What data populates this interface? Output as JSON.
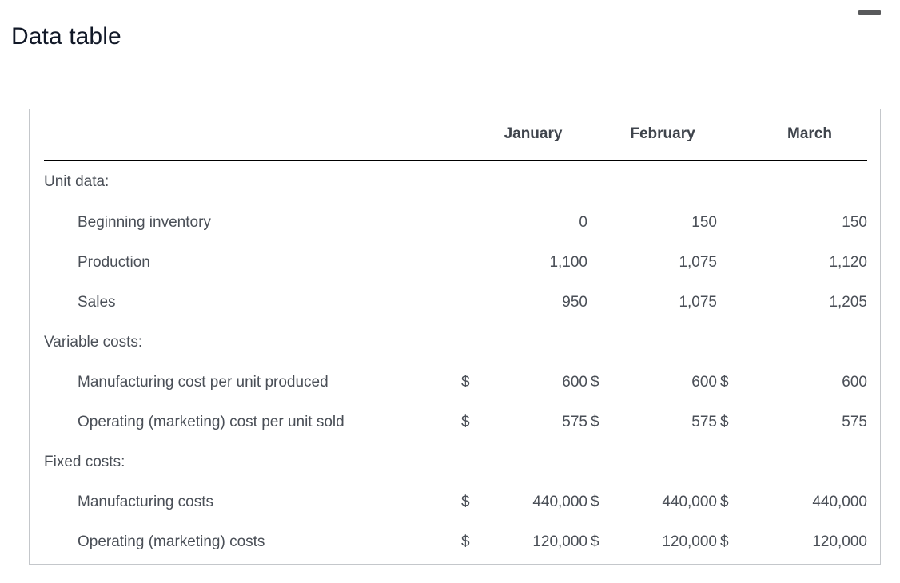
{
  "window": {
    "minimize_icon": "minimize-icon"
  },
  "page_title": "Data table",
  "table": {
    "columns": [
      "",
      "January",
      "February",
      "March"
    ],
    "currency_symbol": "$",
    "rows": [
      {
        "type": "section",
        "label": "Unit data:",
        "values": [
          "",
          "",
          ""
        ],
        "currency": false
      },
      {
        "type": "item",
        "label": "Beginning inventory",
        "values": [
          "0",
          "150",
          "150"
        ],
        "currency": false
      },
      {
        "type": "item",
        "label": "Production",
        "values": [
          "1,100",
          "1,075",
          "1,120"
        ],
        "currency": false
      },
      {
        "type": "item",
        "label": "Sales",
        "values": [
          "950",
          "1,075",
          "1,205"
        ],
        "currency": false
      },
      {
        "type": "section",
        "label": "Variable costs:",
        "values": [
          "",
          "",
          ""
        ],
        "currency": false
      },
      {
        "type": "item",
        "label": "Manufacturing cost per unit produced",
        "values": [
          "600",
          "600",
          "600"
        ],
        "currency": true
      },
      {
        "type": "item",
        "label": "Operating (marketing) cost per unit sold",
        "values": [
          "575",
          "575",
          "575"
        ],
        "currency": true
      },
      {
        "type": "section",
        "label": "Fixed costs:",
        "values": [
          "",
          "",
          ""
        ],
        "currency": false
      },
      {
        "type": "item",
        "label": "Manufacturing costs",
        "values": [
          "440,000",
          "440,000",
          "440,000"
        ],
        "currency": true
      },
      {
        "type": "item",
        "label": "Operating (marketing) costs",
        "values": [
          "120,000",
          "120,000",
          "120,000"
        ],
        "currency": true
      }
    ]
  },
  "colors": {
    "title": "#111827",
    "text": "#4a4f57",
    "header_text": "#3f444c",
    "rule": "#000000",
    "panel_border": "#c4c7cb",
    "minimize": "#58595b"
  }
}
